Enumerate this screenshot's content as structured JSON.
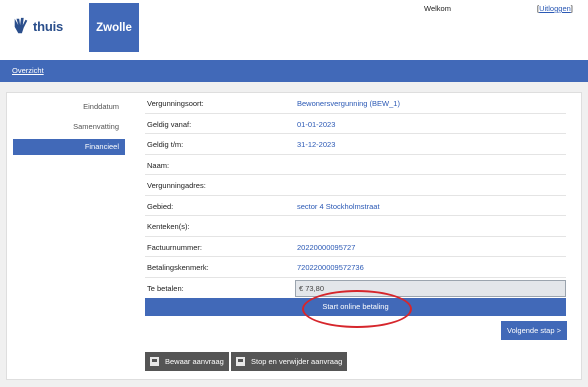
{
  "header": {
    "brand": "thuis",
    "city": "Zwolle",
    "welcome": "Welkom",
    "logout_open": "[",
    "logout_label": "Uitloggen",
    "logout_close": "]"
  },
  "nav": {
    "overview": "Overzicht"
  },
  "sidebar": {
    "items": [
      {
        "label": "Einddatum",
        "active": false
      },
      {
        "label": "Samenvatting",
        "active": false
      },
      {
        "label": "Financieel",
        "active": true
      }
    ]
  },
  "details": {
    "rows": [
      {
        "label": "Vergunningsoort:",
        "value": "Bewonersvergunning (BEW_1)"
      },
      {
        "label": "Geldig vanaf:",
        "value": "01-01-2023"
      },
      {
        "label": "Geldig t/m:",
        "value": "31-12-2023"
      },
      {
        "label": "Naam:",
        "value": ""
      },
      {
        "label": "Vergunningadres:",
        "value": ""
      },
      {
        "label": "Gebied:",
        "value": "sector 4 Stockholmstraat"
      },
      {
        "label": "Kenteken(s):",
        "value": ""
      },
      {
        "label": "Factuurnummer:",
        "value": "20220000095727"
      },
      {
        "label": "Betalingskenmerk:",
        "value": "7202200009572736"
      }
    ],
    "amount_label": "Te betalen:",
    "amount_value": "€ 73,80"
  },
  "actions": {
    "pay": "Start online betaling",
    "next": "Volgende stap >",
    "save": "Bewaar aanvraag",
    "stop": "Stop en verwijder aanvraag"
  },
  "colors": {
    "brand": "#4169b8",
    "highlight": "#d6262c",
    "link": "#2b59b5"
  }
}
